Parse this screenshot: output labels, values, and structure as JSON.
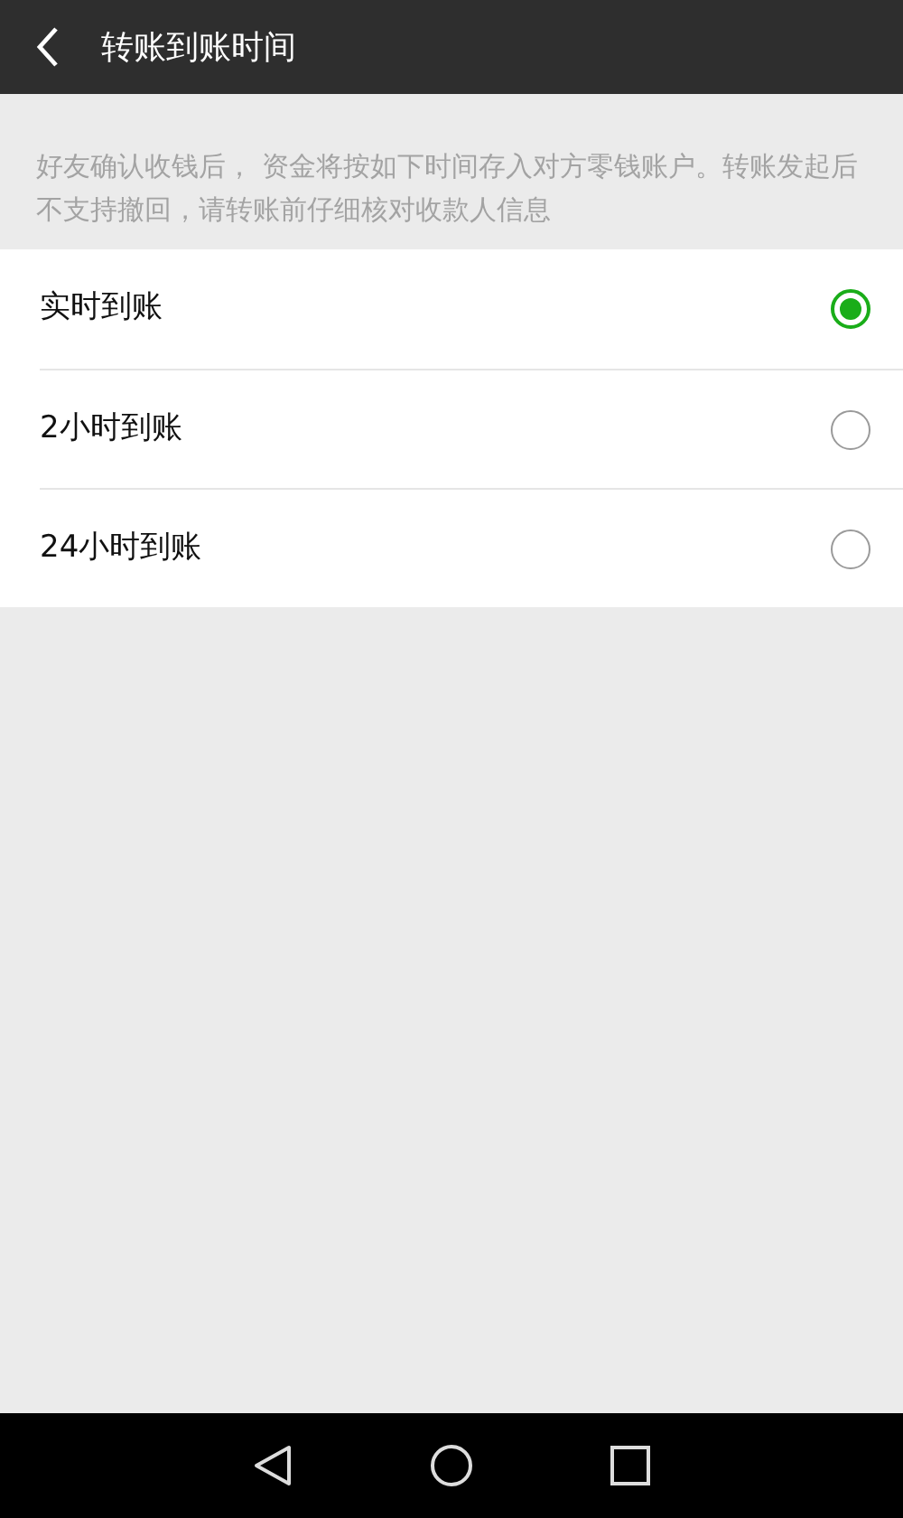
{
  "header": {
    "title": "转账到账时间"
  },
  "description": "好友确认收钱后， 资金将按如下时间存入对方零钱账户。转账发起后不支持撤回，请转账前仔细核对收款人信息",
  "options": [
    {
      "label": "实时到账",
      "selected": true
    },
    {
      "label": "2小时到账",
      "selected": false
    },
    {
      "label": "24小时到账",
      "selected": false
    }
  ]
}
